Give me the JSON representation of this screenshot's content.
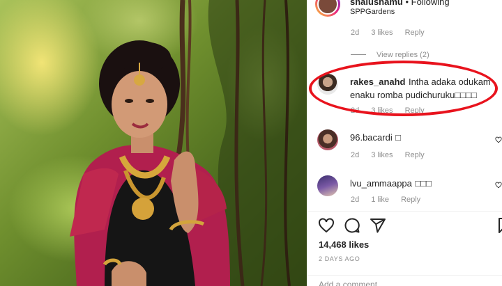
{
  "post": {
    "author": "shalushamu",
    "follow_status": "Following",
    "location": "SPPGardens",
    "likes_text": "14,468 likes",
    "time_ago": "2 DAYS AGO",
    "add_comment_placeholder": "Add a comment..."
  },
  "comments": [
    {
      "username": "",
      "text": "",
      "age": "2d",
      "likes": "3 likes",
      "reply": "Reply",
      "view_replies": "View replies (2)"
    },
    {
      "username": "rakes_anahd",
      "text_line1": "Intha adaka odukam",
      "text_line2": "enaku romba pudichuruku□□□□",
      "age": "2d",
      "likes": "3 likes",
      "reply": "Reply"
    },
    {
      "username": "96.bacardi",
      "text": "□",
      "age": "2d",
      "likes": "3 likes",
      "reply": "Reply"
    },
    {
      "username": "lvu_ammaappa",
      "text": "□□□",
      "age": "2d",
      "likes": "1 like",
      "reply": "Reply"
    }
  ],
  "icons": [
    "heart-icon",
    "comment-icon",
    "share-icon",
    "bookmark-icon",
    "small-heart-icon"
  ],
  "colors": {
    "highlight_oval": "#e8131d",
    "link": "#00376b",
    "muted": "#8e8e8e"
  }
}
